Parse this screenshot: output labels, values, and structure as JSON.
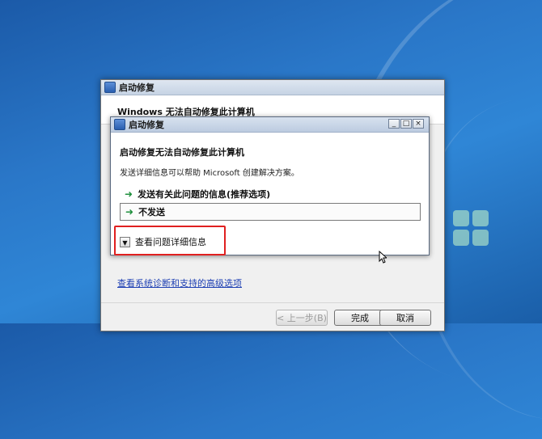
{
  "outer_window": {
    "title": "启动修复",
    "heading": "Windows 无法自动修复此计算机",
    "advanced_link": "查看系统诊断和支持的高级选项",
    "buttons": {
      "back": "< 上一步(B)",
      "finish": "完成",
      "cancel": "取消"
    }
  },
  "inner_dialog": {
    "title": "启动修复",
    "heading": "启动修复无法自动修复此计算机",
    "description": "发送详细信息可以帮助 Microsoft 创建解决方案。",
    "options": [
      {
        "label": "发送有关此问题的信息(推荐选项)"
      },
      {
        "label": "不发送"
      }
    ],
    "details_toggle": "查看问题详细信息",
    "controls": {
      "minimize": "_",
      "maximize": "□",
      "close": "×"
    }
  },
  "colors": {
    "highlight_box": "#e02020",
    "option_arrow": "#1e8f3c",
    "link": "#1d3fb3"
  },
  "icons": {
    "option_arrow": "green-arrow-icon",
    "toggle": "chevron-down-icon"
  }
}
